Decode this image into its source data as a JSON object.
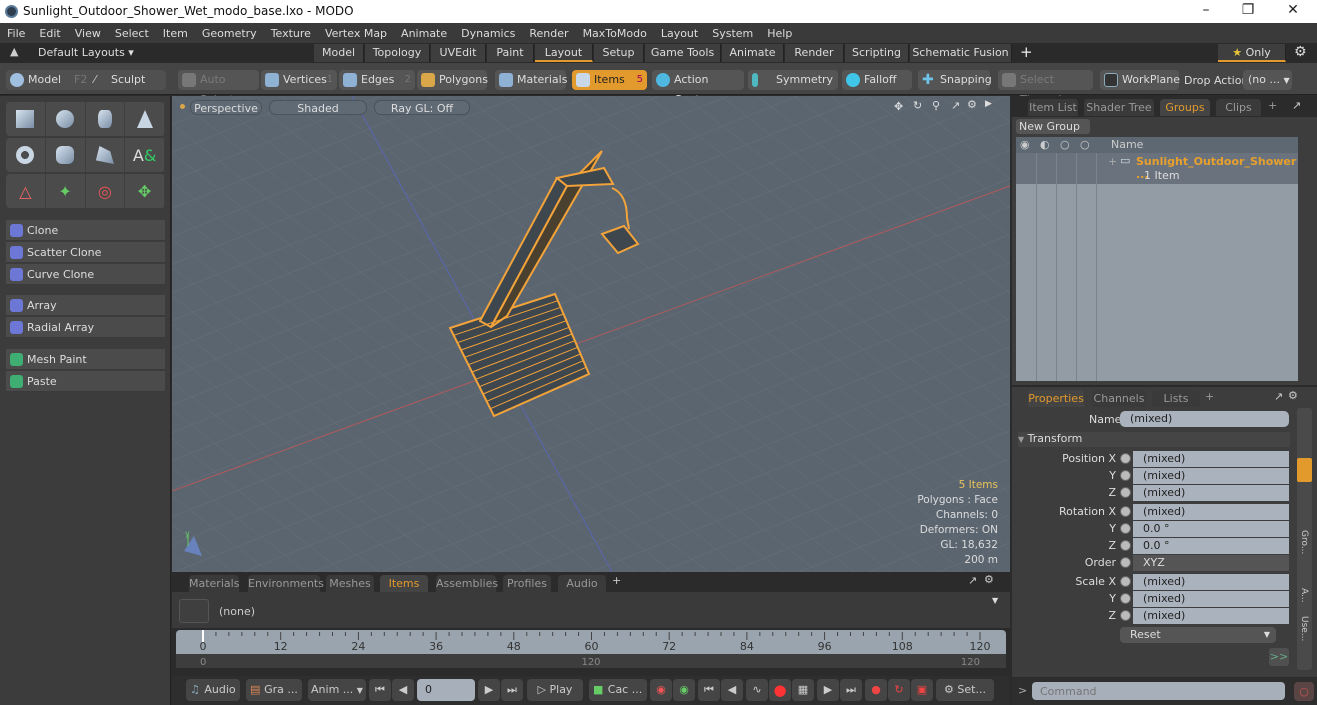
{
  "window": {
    "title": "Sunlight_Outdoor_Shower_Wet_modo_base.lxo - MODO",
    "controls": [
      "minimize",
      "restore",
      "close"
    ]
  },
  "menu": [
    "File",
    "Edit",
    "View",
    "Select",
    "Item",
    "Geometry",
    "Texture",
    "Vertex Map",
    "Animate",
    "Dynamics",
    "Render",
    "MaxToModo",
    "Layout",
    "System",
    "Help"
  ],
  "layouts": {
    "label": "Default Layouts ▾",
    "tabs": [
      "Model",
      "Topology",
      "UVEdit",
      "Paint",
      "Layout",
      "Setup",
      "Game Tools",
      "Animate",
      "Render",
      "Scripting",
      "Schematic Fusion"
    ],
    "active": "Layout",
    "add": "+",
    "only": "Only"
  },
  "toolbar": {
    "model": "Model",
    "model_key": "F2",
    "sculpt": "Sculpt",
    "auto_select": "Auto Select",
    "vertices": "Vertices",
    "vertices_num": "1",
    "edges": "Edges",
    "edges_num": "2",
    "polygons": "Polygons",
    "materials": "Materials",
    "items": "Items",
    "items_num": "5",
    "action_center": "Action Center",
    "symmetry": "Symmetry",
    "falloff": "Falloff",
    "snapping": "Snapping",
    "select_through": "Select Through",
    "workplane": "WorkPlane",
    "drop_action": "Drop Action",
    "drop_value": "(no ..."
  },
  "left_panel": {
    "buttons": [
      "Clone",
      "Scatter Clone",
      "Curve Clone",
      "Array",
      "Radial Array",
      "Mesh Paint",
      "Paste"
    ]
  },
  "viewport": {
    "view": "Perspective",
    "shading": "Shaded",
    "raygl": "Ray GL: Off",
    "stats": {
      "items": "5 Items",
      "polygons": "Polygons : Face",
      "channels": "Channels: 0",
      "deformers": "Deformers: ON",
      "gl": "GL: 18,632",
      "scale": "200 m"
    }
  },
  "bottom_tabs": {
    "tabs": [
      "Materials",
      "Environments",
      "Meshes",
      "Items",
      "Assemblies",
      "Profiles",
      "Audio"
    ],
    "active": "Items",
    "add": "+"
  },
  "item_selector": {
    "value": "(none)"
  },
  "timeline": {
    "ticks": [
      "0",
      "12",
      "24",
      "36",
      "48",
      "60",
      "72",
      "84",
      "96",
      "108",
      "120"
    ],
    "range_start": "0",
    "range_mid": "120",
    "range_end": "120",
    "current": 0
  },
  "transport": {
    "audio": "Audio",
    "graph": "Gra ...",
    "anim": "Anim ...",
    "frame": "0",
    "play": "Play",
    "cache": "Cac ...",
    "settings": "Set..."
  },
  "right_tabs": {
    "tabs": [
      "Item List",
      "Shader Tree",
      "Groups",
      "Clips"
    ],
    "active": "Groups",
    "add": "+"
  },
  "groups": {
    "new_group": "New Group",
    "col_name": "Name",
    "rows": [
      {
        "name": "Sunlight_Outdoor_Shower ...",
        "sub": "1 Item"
      }
    ]
  },
  "props_tabs": {
    "tabs": [
      "Properties",
      "Channels",
      "Lists"
    ],
    "active": "Properties",
    "add": "+"
  },
  "properties": {
    "name_label": "Name",
    "name_value": "(mixed)",
    "section": "Transform",
    "rows": [
      {
        "label": "Position X",
        "value": "(mixed)"
      },
      {
        "label": "Y",
        "value": "(mixed)"
      },
      {
        "label": "Z",
        "value": "(mixed)"
      },
      {
        "label": "Rotation X",
        "value": "(mixed)"
      },
      {
        "label": "Y",
        "value": "0.0 °"
      },
      {
        "label": "Z",
        "value": "0.0 °"
      },
      {
        "label": "Order",
        "value": "XYZ"
      },
      {
        "label": "Scale X",
        "value": "(mixed)"
      },
      {
        "label": "Y",
        "value": "(mixed)"
      },
      {
        "label": "Z",
        "value": "(mixed)"
      }
    ],
    "reset": "Reset",
    "more": ">>",
    "side_tabs": [
      "Gro...",
      "A...",
      "Use..."
    ]
  },
  "command": {
    "placeholder": "Command",
    "prompt": ">"
  },
  "colors": {
    "accent": "#e29a2c",
    "viewport": "#5b6570",
    "panel": "#3d3d3d"
  }
}
